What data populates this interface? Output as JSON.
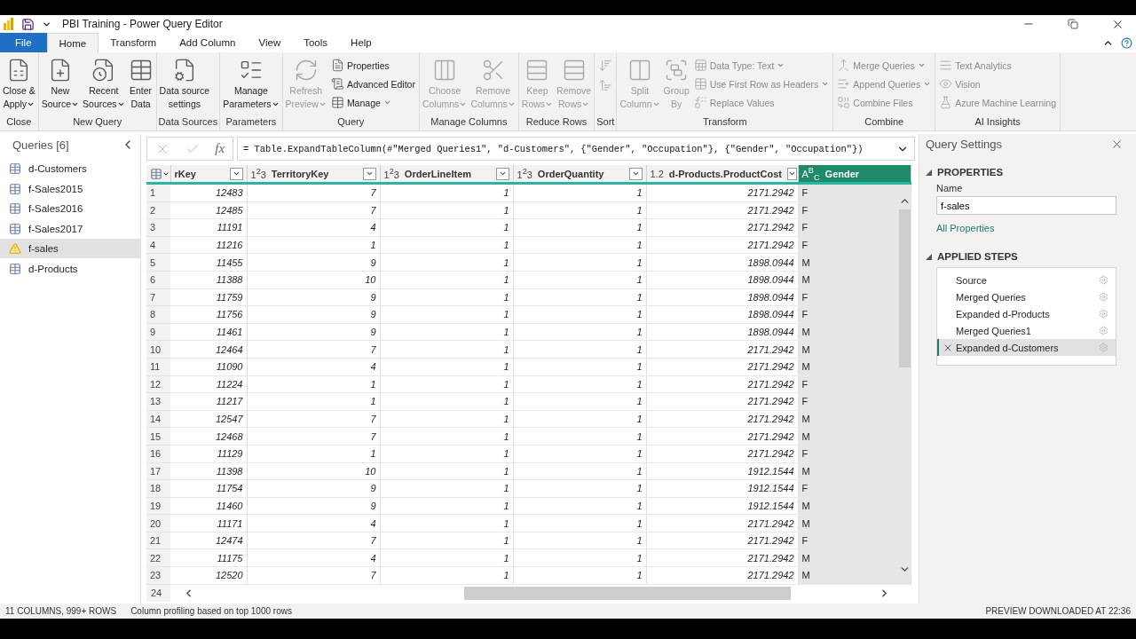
{
  "window": {
    "title": "PBI Training - Power Query Editor"
  },
  "menu_tabs": [
    {
      "label": "File",
      "kind": "file",
      "selected": false
    },
    {
      "label": "Home",
      "kind": "tab",
      "selected": true
    },
    {
      "label": "Transform",
      "kind": "tab",
      "selected": false
    },
    {
      "label": "Add Column",
      "kind": "tab",
      "selected": false
    },
    {
      "label": "View",
      "kind": "tab",
      "selected": false
    },
    {
      "label": "Tools",
      "kind": "tab",
      "selected": false
    },
    {
      "label": "Help",
      "kind": "tab",
      "selected": false
    }
  ],
  "ribbon": {
    "groups": [
      {
        "label": "Close",
        "items": [
          {
            "kind": "large",
            "lines": [
              "Close &",
              "Apply"
            ],
            "dropdown": true,
            "disabled": false
          }
        ]
      },
      {
        "label": "New Query",
        "items": [
          {
            "kind": "large",
            "lines": [
              "New",
              "Source"
            ],
            "dropdown": true,
            "disabled": false
          },
          {
            "kind": "large",
            "lines": [
              "Recent",
              "Sources"
            ],
            "dropdown": true,
            "disabled": false
          },
          {
            "kind": "large",
            "lines": [
              "Enter",
              "Data"
            ],
            "dropdown": false,
            "disabled": false
          }
        ]
      },
      {
        "label": "Data Sources",
        "items": [
          {
            "kind": "large",
            "lines": [
              "Data source",
              "settings"
            ],
            "dropdown": false,
            "disabled": false
          }
        ]
      },
      {
        "label": "Parameters",
        "items": [
          {
            "kind": "large",
            "lines": [
              "Manage",
              "Parameters"
            ],
            "dropdown": true,
            "disabled": false
          }
        ]
      },
      {
        "label": "Query",
        "items": [
          {
            "kind": "large",
            "lines": [
              "Refresh",
              "Preview"
            ],
            "dropdown": true,
            "disabled": true
          },
          {
            "kind": "small",
            "lines": [
              "Properties"
            ],
            "dropdown": false,
            "disabled": false
          },
          {
            "kind": "small",
            "lines": [
              "Advanced Editor"
            ],
            "dropdown": false,
            "disabled": false
          },
          {
            "kind": "small",
            "lines": [
              "Manage"
            ],
            "dropdown": true,
            "disabled": false
          }
        ]
      },
      {
        "label": "Manage Columns",
        "items": [
          {
            "kind": "large",
            "lines": [
              "Choose",
              "Columns"
            ],
            "dropdown": true,
            "disabled": true
          },
          {
            "kind": "large",
            "lines": [
              "Remove",
              "Columns"
            ],
            "dropdown": true,
            "disabled": true
          }
        ]
      },
      {
        "label": "Reduce Rows",
        "items": [
          {
            "kind": "large",
            "lines": [
              "Keep",
              "Rows"
            ],
            "dropdown": true,
            "disabled": true
          },
          {
            "kind": "large",
            "lines": [
              "Remove",
              "Rows"
            ],
            "dropdown": true,
            "disabled": true
          }
        ]
      },
      {
        "label": "Sort",
        "items": [
          {
            "kind": "icon",
            "disabled": true
          },
          {
            "kind": "icon",
            "disabled": true
          }
        ]
      },
      {
        "label": "Transform",
        "items": [
          {
            "kind": "large",
            "lines": [
              "Split",
              "Column"
            ],
            "dropdown": true,
            "disabled": true
          },
          {
            "kind": "large",
            "lines": [
              "Group",
              "By"
            ],
            "dropdown": false,
            "disabled": true
          },
          {
            "kind": "small",
            "lines": [
              "Data Type: Text"
            ],
            "dropdown": true,
            "disabled": true
          },
          {
            "kind": "small",
            "lines": [
              "Use First Row as Headers"
            ],
            "dropdown": true,
            "disabled": true
          },
          {
            "kind": "small",
            "lines": [
              "Replace Values"
            ],
            "dropdown": false,
            "disabled": true
          }
        ]
      },
      {
        "label": "Combine",
        "items": [
          {
            "kind": "small",
            "lines": [
              "Merge Queries"
            ],
            "dropdown": true,
            "disabled": true
          },
          {
            "kind": "small",
            "lines": [
              "Append Queries"
            ],
            "dropdown": true,
            "disabled": true
          },
          {
            "kind": "small",
            "lines": [
              "Combine Files"
            ],
            "dropdown": false,
            "disabled": true
          }
        ]
      },
      {
        "label": "AI Insights",
        "items": [
          {
            "kind": "small",
            "lines": [
              "Text Analytics"
            ],
            "dropdown": false,
            "disabled": true
          },
          {
            "kind": "small",
            "lines": [
              "Vision"
            ],
            "dropdown": false,
            "disabled": true
          },
          {
            "kind": "small",
            "lines": [
              "Azure Machine Learning"
            ],
            "dropdown": false,
            "disabled": true
          }
        ]
      }
    ]
  },
  "queries": {
    "title": "Queries [6]",
    "items": [
      {
        "name": "d-Customers",
        "kind": "table",
        "selected": false
      },
      {
        "name": "f-Sales2015",
        "kind": "table",
        "selected": false
      },
      {
        "name": "f-Sales2016",
        "kind": "table",
        "selected": false
      },
      {
        "name": "f-Sales2017",
        "kind": "table",
        "selected": false
      },
      {
        "name": "f-sales",
        "kind": "warning",
        "selected": true
      },
      {
        "name": "d-Products",
        "kind": "table",
        "selected": false
      }
    ]
  },
  "formula_bar": {
    "function_label": "fx",
    "formula": "= Table.ExpandTableColumn(#\"Merged Queries1\", \"d-Customers\", {\"Gender\", \"Occupation\"}, {\"Gender\", \"Occupation\"})"
  },
  "table": {
    "columns": [
      {
        "name": "rKey",
        "kind": "number",
        "selected": false
      },
      {
        "name": "TerritoryKey",
        "type_label": "1$^{2}$3",
        "kind": "number",
        "selected": false
      },
      {
        "name": "OrderLineItem",
        "type_label": "1$^{2}$3",
        "kind": "number",
        "selected": false
      },
      {
        "name": "OrderQuantity",
        "type_label": "1$^{2}$3",
        "kind": "number",
        "selected": false
      },
      {
        "name": "d-Products.ProductCost",
        "type_label": "1.2",
        "kind": "number",
        "selected": false
      },
      {
        "name": "Gender",
        "type_label": "A$^{B}$$_{C}$",
        "kind": "text",
        "selected": true
      }
    ],
    "rows": [
      {
        "number": "1",
        "cells": [
          "12483",
          "7",
          "1",
          "1",
          "2171.2942",
          "F"
        ]
      },
      {
        "number": "2",
        "cells": [
          "12485",
          "7",
          "1",
          "1",
          "2171.2942",
          "F"
        ]
      },
      {
        "number": "3",
        "cells": [
          "11191",
          "4",
          "1",
          "1",
          "2171.2942",
          "F"
        ]
      },
      {
        "number": "4",
        "cells": [
          "11216",
          "1",
          "1",
          "1",
          "2171.2942",
          "F"
        ]
      },
      {
        "number": "5",
        "cells": [
          "11455",
          "9",
          "1",
          "1",
          "1898.0944",
          "M"
        ]
      },
      {
        "number": "6",
        "cells": [
          "11388",
          "10",
          "1",
          "1",
          "1898.0944",
          "M"
        ]
      },
      {
        "number": "7",
        "cells": [
          "11759",
          "9",
          "1",
          "1",
          "1898.0944",
          "F"
        ]
      },
      {
        "number": "8",
        "cells": [
          "11756",
          "9",
          "1",
          "1",
          "1898.0944",
          "F"
        ]
      },
      {
        "number": "9",
        "cells": [
          "11461",
          "9",
          "1",
          "1",
          "1898.0944",
          "M"
        ]
      },
      {
        "number": "10",
        "cells": [
          "12464",
          "7",
          "1",
          "1",
          "2171.2942",
          "M"
        ]
      },
      {
        "number": "11",
        "cells": [
          "11090",
          "4",
          "1",
          "1",
          "2171.2942",
          "M"
        ]
      },
      {
        "number": "12",
        "cells": [
          "11224",
          "1",
          "1",
          "1",
          "2171.2942",
          "F"
        ]
      },
      {
        "number": "13",
        "cells": [
          "11217",
          "1",
          "1",
          "1",
          "2171.2942",
          "F"
        ]
      },
      {
        "number": "14",
        "cells": [
          "12547",
          "7",
          "1",
          "1",
          "2171.2942",
          "M"
        ]
      },
      {
        "number": "15",
        "cells": [
          "12468",
          "7",
          "1",
          "1",
          "2171.2942",
          "M"
        ]
      },
      {
        "number": "16",
        "cells": [
          "11129",
          "1",
          "1",
          "1",
          "2171.2942",
          "F"
        ]
      },
      {
        "number": "17",
        "cells": [
          "11398",
          "10",
          "1",
          "1",
          "1912.1544",
          "M"
        ]
      },
      {
        "number": "18",
        "cells": [
          "11754",
          "9",
          "1",
          "1",
          "1912.1544",
          "F"
        ]
      },
      {
        "number": "19",
        "cells": [
          "11460",
          "9",
          "1",
          "1",
          "1912.1544",
          "M"
        ]
      },
      {
        "number": "20",
        "cells": [
          "11171",
          "4",
          "1",
          "1",
          "2171.2942",
          "M"
        ]
      },
      {
        "number": "21",
        "cells": [
          "12474",
          "7",
          "1",
          "1",
          "2171.2942",
          "F"
        ]
      },
      {
        "number": "22",
        "cells": [
          "11175",
          "4",
          "1",
          "1",
          "2171.2942",
          "M"
        ]
      },
      {
        "number": "23",
        "cells": [
          "12520",
          "7",
          "1",
          "1",
          "2171.2942",
          "M"
        ]
      }
    ],
    "partial_row_number": "24"
  },
  "query_settings": {
    "title": "Query Settings",
    "properties_heading": "PROPERTIES",
    "name_label": "Name",
    "name_value": "f-sales",
    "all_properties_link": "All Properties",
    "steps_heading": "APPLIED STEPS",
    "steps": [
      {
        "name": "Source",
        "selected": false
      },
      {
        "name": "Merged Queries",
        "selected": false
      },
      {
        "name": "Expanded d-Products",
        "selected": false
      },
      {
        "name": "Merged Queries1",
        "selected": false
      },
      {
        "name": "Expanded d-Customers",
        "selected": true
      }
    ]
  },
  "status_bar": {
    "left": [
      "11 COLUMNS, 999+ ROWS",
      "Column profiling based on top 1000 rows"
    ],
    "right": "PREVIEW DOWNLOADED AT 22:36"
  }
}
